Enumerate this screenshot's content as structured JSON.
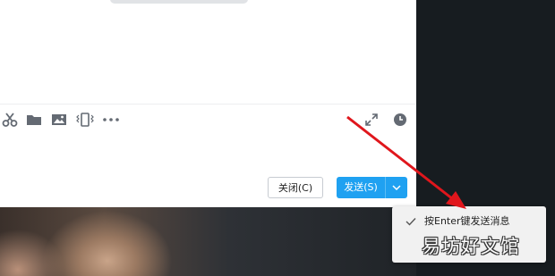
{
  "chat": {
    "buttons": {
      "close_label": "关闭(C)",
      "send_label": "发送(S)"
    },
    "toolbar_icons": [
      "scissors-icon",
      "folder-icon",
      "image-icon",
      "vibrate-icon",
      "more-icon",
      "expand-icon",
      "history-clock-icon"
    ]
  },
  "tooltip": {
    "option_label": "按Enter键发送消息",
    "checked": true
  },
  "watermark": {
    "text": "易坊好文馆"
  },
  "colors": {
    "send_button": "#1fa1f1",
    "annotation_arrow": "#e0161c",
    "icon_gray": "#646a73"
  }
}
